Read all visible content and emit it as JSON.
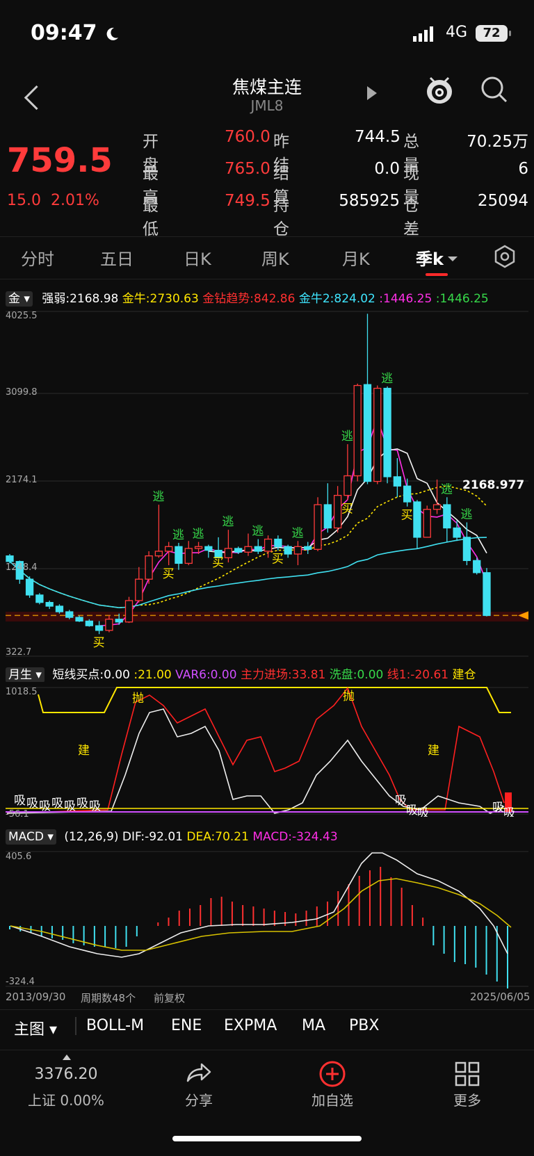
{
  "status": {
    "time": "09:47",
    "network": "4G",
    "battery": "72"
  },
  "nav": {
    "title": "焦煤主连",
    "code": "JML8"
  },
  "quote": {
    "price": "759.5",
    "change": "15.0",
    "change_pct": "2.01%",
    "rows": [
      {
        "l1": "开盘",
        "v1": "760.0",
        "l2": "昨结",
        "v2": "744.5",
        "l3": "总量",
        "v3": "70.25万"
      },
      {
        "l1": "最高",
        "v1": "765.0",
        "l2": "结算",
        "v2": "0.0",
        "l3": "现量",
        "v3": "6"
      },
      {
        "l1": "最低",
        "v1": "749.5",
        "l2": "持仓",
        "v2": "585925",
        "l3": "仓差",
        "v3": "25094"
      }
    ]
  },
  "periods": [
    "分时",
    "五日",
    "日K",
    "周K",
    "月K",
    "季k"
  ],
  "main_indicator": {
    "selector": "金",
    "items": [
      {
        "label": "强弱:2168.98",
        "color": "#ffffff"
      },
      {
        "label": "金牛:2730.63",
        "color": "#ffe600"
      },
      {
        "label": "金钻趋势:842.86",
        "color": "#ff3030"
      },
      {
        "label": "金牛2:824.02",
        "color": "#3fe6ff"
      },
      {
        "label": ":1446.25",
        "color": "#ff2fe6"
      },
      {
        "label": ":1446.25",
        "color": "#37d94a"
      }
    ],
    "y_ticks": [
      "4025.5",
      "3099.8",
      "2174.1",
      "1248.4",
      "322.7"
    ],
    "last_label": "2168.977"
  },
  "sub_indicator": {
    "selector": "月生",
    "items": [
      {
        "label": "短线买点:0.00",
        "color": "#ffffff"
      },
      {
        "label": ":21.00",
        "color": "#ffe600"
      },
      {
        "label": "VAR6:0.00",
        "color": "#d04fff"
      },
      {
        "label": "主力进场:33.81",
        "color": "#ff3030"
      },
      {
        "label": "洗盘:0.00",
        "color": "#37d94a"
      },
      {
        "label": "线1:-20.61",
        "color": "#ff3030"
      },
      {
        "label": "建仓",
        "color": "#ffe600"
      }
    ],
    "y_ticks": [
      "1018.5",
      "-56.1"
    ]
  },
  "macd": {
    "selector": "MACD",
    "items": [
      {
        "label": "(12,26,9) DIF:-92.01",
        "color": "#ffffff"
      },
      {
        "label": "DEA:70.21",
        "color": "#ffe600"
      },
      {
        "label": "MACD:-324.43",
        "color": "#ff2fe6"
      }
    ],
    "y_ticks": [
      "405.6",
      "-324.4"
    ]
  },
  "footer_axis": {
    "start": "2013/09/30",
    "count": "周期数48个",
    "adj": "前复权",
    "end": "2025/06/05"
  },
  "overlays": [
    "主图",
    "BOLL-M",
    "ENE",
    "EXPMA",
    "MA",
    "PBX"
  ],
  "bottom": {
    "index_value": "3376.20",
    "index_label": "上证 0.00%",
    "share": "分享",
    "add": "加自选",
    "more": "更多"
  },
  "marks": {
    "escape": "逃",
    "buy": "买",
    "throw": "抛",
    "build": "建",
    "absorb": "吸"
  },
  "colors": {
    "up": "#ff3b3b",
    "down": "#40e0f0",
    "bg": "#0d0d0d"
  },
  "chart_data": {
    "type": "candlestick",
    "x_range": [
      "2013/09/30",
      "2025/06/05"
    ],
    "ylim": [
      322.7,
      4025.5
    ],
    "ohlc": [
      [
        1400,
        1420,
        1320,
        1340
      ],
      [
        1340,
        1350,
        1100,
        1150
      ],
      [
        1150,
        1180,
        950,
        980
      ],
      [
        980,
        1000,
        880,
        900
      ],
      [
        900,
        920,
        830,
        860
      ],
      [
        860,
        880,
        780,
        800
      ],
      [
        800,
        820,
        720,
        740
      ],
      [
        740,
        760,
        690,
        700
      ],
      [
        700,
        720,
        640,
        650
      ],
      [
        650,
        700,
        560,
        600
      ],
      [
        600,
        760,
        580,
        720
      ],
      [
        720,
        780,
        660,
        690
      ],
      [
        690,
        960,
        680,
        920
      ],
      [
        920,
        1280,
        900,
        1150
      ],
      [
        1150,
        1450,
        1100,
        1400
      ],
      [
        1400,
        1950,
        1380,
        1450
      ],
      [
        1450,
        1550,
        1300,
        1500
      ],
      [
        1500,
        1540,
        1250,
        1320
      ],
      [
        1320,
        1560,
        1300,
        1480
      ],
      [
        1480,
        1550,
        1420,
        1500
      ],
      [
        1500,
        1520,
        1380,
        1460
      ],
      [
        1460,
        1600,
        1420,
        1380
      ],
      [
        1380,
        1680,
        1330,
        1480
      ],
      [
        1480,
        1500,
        1420,
        1440
      ],
      [
        1440,
        1640,
        1400,
        1500
      ],
      [
        1500,
        1580,
        1420,
        1450
      ],
      [
        1450,
        1620,
        1380,
        1580
      ],
      [
        1580,
        1620,
        1460,
        1500
      ],
      [
        1500,
        1520,
        1380,
        1420
      ],
      [
        1420,
        1560,
        1300,
        1500
      ],
      [
        1500,
        1550,
        1420,
        1470
      ],
      [
        1470,
        2030,
        1450,
        1950
      ],
      [
        1950,
        2180,
        1650,
        1700
      ],
      [
        1700,
        2150,
        1650,
        2050
      ],
      [
        2050,
        2600,
        2000,
        2260
      ],
      [
        2260,
        3250,
        2200,
        3230
      ],
      [
        3240,
        4000,
        2170,
        2200
      ],
      [
        2200,
        3230,
        2170,
        3200
      ],
      [
        3200,
        3220,
        2180,
        2250
      ],
      [
        2250,
        2450,
        2030,
        2150
      ],
      [
        2150,
        2230,
        1930,
        1980
      ],
      [
        1980,
        2000,
        1480,
        1600
      ],
      [
        1600,
        1940,
        1600,
        1900
      ],
      [
        1900,
        2220,
        1850,
        1950
      ],
      [
        1950,
        2030,
        1550,
        1700
      ],
      [
        1700,
        1780,
        1560,
        1600
      ],
      [
        1600,
        1760,
        1300,
        1350
      ],
      [
        1350,
        1380,
        1200,
        1220
      ],
      [
        1220,
        1270,
        750,
        760
      ]
    ]
  }
}
